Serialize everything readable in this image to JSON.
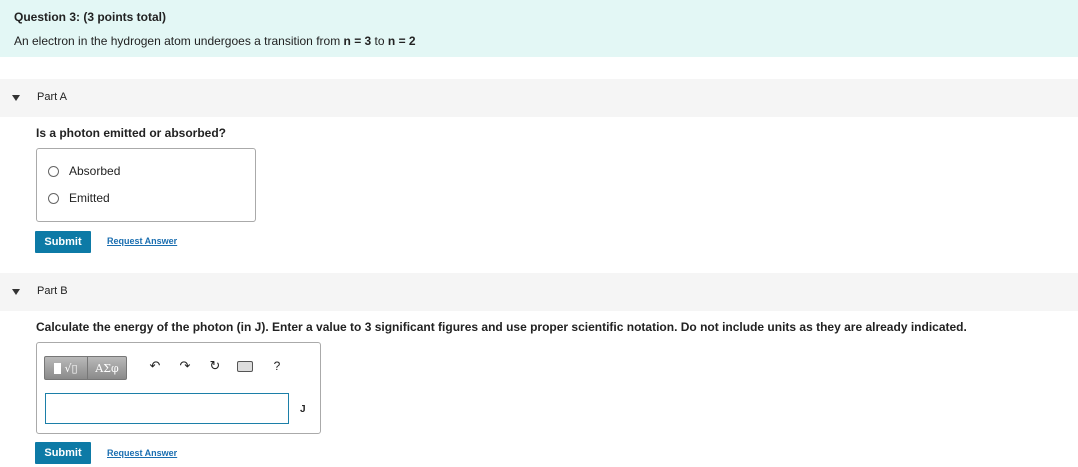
{
  "question": {
    "title": "Question 3: (3 points total)",
    "text_prefix": "An electron in the hydrogen atom undergoes a transition from ",
    "text_bold": "n = 3",
    "text_mid": " to ",
    "text_bold2": "n = 2"
  },
  "partA": {
    "label": "Part A",
    "prompt": "Is a photon emitted or absorbed?",
    "options": [
      "Absorbed",
      "Emitted"
    ],
    "submit_label": "Submit",
    "request_label": "Request Answer"
  },
  "partB": {
    "label": "Part B",
    "prompt": "Calculate the energy of the photon (in J). Enter a value to 3 significant figures and use proper scientific notation. Do not include units as they are already indicated.",
    "toolbar": {
      "template_icon": "template-radical-icon",
      "greek_label": "ΑΣφ",
      "undo_icon": "undo-icon",
      "redo_icon": "redo-icon",
      "reset_icon": "reset-icon",
      "keyboard_icon": "keyboard-icon",
      "help_label": "?"
    },
    "answer_value": "",
    "unit": "J",
    "submit_label": "Submit",
    "request_label": "Request Answer"
  },
  "colors": {
    "header_bg": "#e3f7f5",
    "submit_bg": "#0d7aa6",
    "link": "#1a6eb0",
    "input_border": "#1c7fa8"
  }
}
